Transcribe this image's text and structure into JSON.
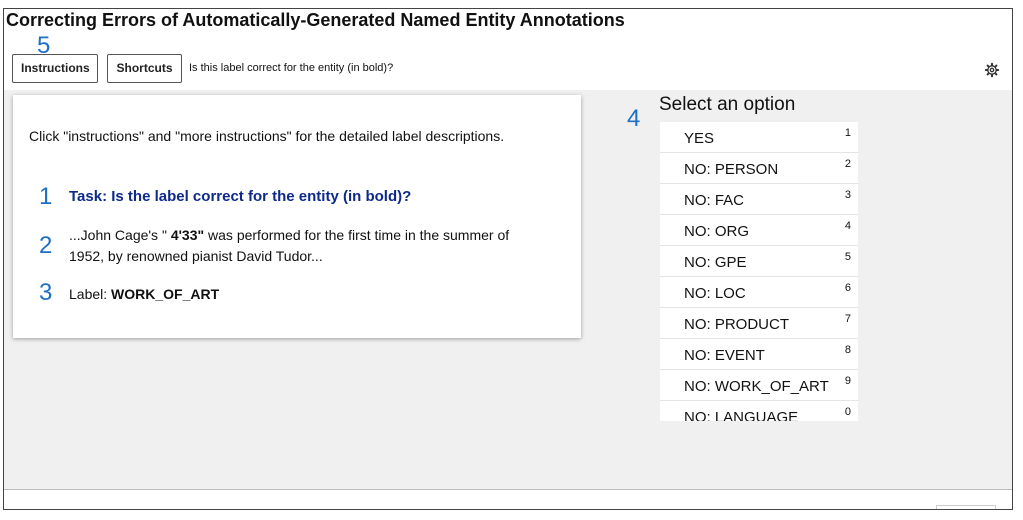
{
  "title": "Correcting Errors of Automatically-Generated Named Entity Annotations",
  "markers": {
    "m1": "1",
    "m2": "2",
    "m3": "3",
    "m4": "4",
    "m5": "5"
  },
  "toolbar": {
    "instructions_label": "Instructions",
    "shortcuts_label": "Shortcuts",
    "question": "Is this label correct for the entity (in bold)?",
    "settings_icon": "gear-icon"
  },
  "card": {
    "instructions_text": "Click \"instructions\" and \"more instructions\" for the detailed label descriptions.",
    "task": "Task: Is the label correct for the entity (in bold)?",
    "context_before": "...John Cage's \" ",
    "entity": "4'33\"",
    "context_after": " was performed for the first time in the summer of 1952, by renowned pianist David Tudor...",
    "label_prefix": "Label: ",
    "label_value": "WORK_OF_ART"
  },
  "options_panel": {
    "title": "Select an option",
    "options": [
      {
        "label": "YES",
        "key": "1"
      },
      {
        "label": "NO: PERSON",
        "key": "2"
      },
      {
        "label": "NO: FAC",
        "key": "3"
      },
      {
        "label": "NO: ORG",
        "key": "4"
      },
      {
        "label": "NO: GPE",
        "key": "5"
      },
      {
        "label": "NO: LOC",
        "key": "6"
      },
      {
        "label": "NO: PRODUCT",
        "key": "7"
      },
      {
        "label": "NO: EVENT",
        "key": "8"
      },
      {
        "label": "NO: WORK_OF_ART",
        "key": "9"
      },
      {
        "label": "NO: LANGUAGE",
        "key": "0"
      }
    ]
  }
}
